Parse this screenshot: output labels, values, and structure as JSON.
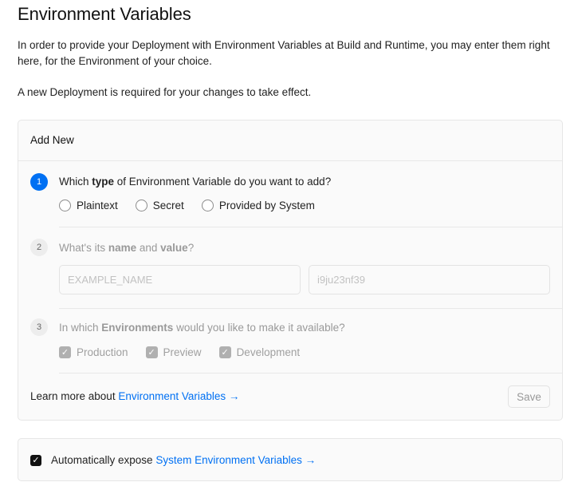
{
  "page": {
    "title": "Environment Variables",
    "description": "In order to provide your Deployment with Environment Variables at Build and Runtime, you may enter them right here, for the Environment of your choice.",
    "note": "A new Deployment is required for your changes to take effect."
  },
  "add_new": {
    "title": "Add New",
    "step1": {
      "number": "1",
      "pre": "Which ",
      "bold": "type",
      "post": " of Environment Variable do you want to add?",
      "options": [
        "Plaintext",
        "Secret",
        "Provided by System"
      ]
    },
    "step2": {
      "number": "2",
      "pre": "What's its ",
      "bold1": "name",
      "mid": " and ",
      "bold2": "value",
      "post": "?",
      "name_placeholder": "EXAMPLE_NAME",
      "value_placeholder": "i9ju23nf39"
    },
    "step3": {
      "number": "3",
      "pre": "In which ",
      "bold": "Environments",
      "post": " would you like to make it available?",
      "options": [
        "Production",
        "Preview",
        "Development"
      ]
    },
    "learn_more_text": "Learn more about ",
    "learn_more_link": "Environment Variables →",
    "save_label": "Save"
  },
  "auto_expose": {
    "text": "Automatically expose ",
    "link": "System Environment Variables →",
    "checked": true
  },
  "colors": {
    "accent": "#0070f3",
    "card_bg": "#fafafa",
    "border": "#e6e6e6",
    "muted_text": "#999999"
  }
}
